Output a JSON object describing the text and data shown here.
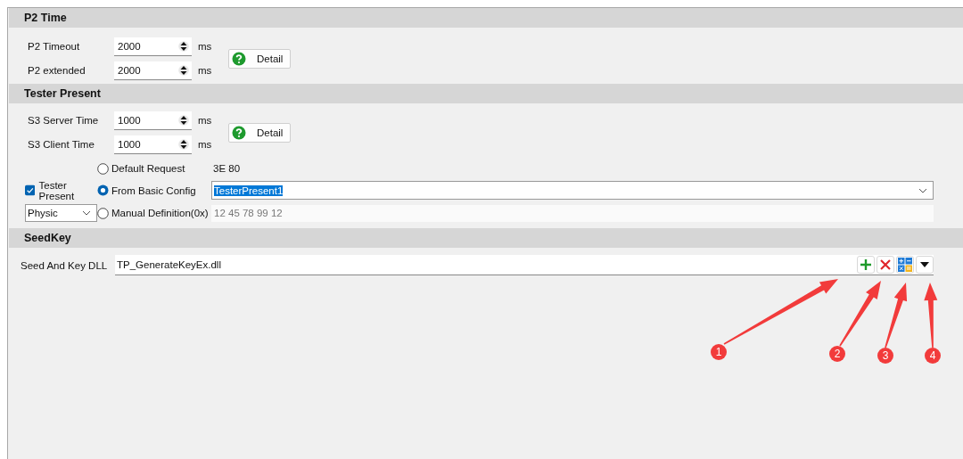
{
  "sections": [
    {
      "kind": "timing",
      "title": "P2 Time",
      "fields": [
        {
          "label": "P2 Timeout",
          "value": "2000",
          "unit": "ms"
        },
        {
          "label": "P2 extended",
          "value": "2000",
          "unit": "ms"
        }
      ],
      "detail_button": "Detail"
    },
    {
      "kind": "tester",
      "title": "Tester Present",
      "fields": [
        {
          "label": "S3 Server Time",
          "value": "1000",
          "unit": "ms"
        },
        {
          "label": "S3 Client Time",
          "value": "1000",
          "unit": "ms"
        }
      ],
      "detail_button": "Detail",
      "tester_present": {
        "label": "Tester Present",
        "checked": true
      },
      "addressing": "Physic",
      "options": [
        {
          "kind": "text",
          "label": "Default Request",
          "selected": false,
          "value": "3E 80"
        },
        {
          "kind": "combo",
          "label": "From Basic Config",
          "selected": true,
          "value": "TesterPresent1"
        },
        {
          "kind": "input",
          "label": "Manual Definition(0x)",
          "selected": false,
          "value": "12 45 78 99 12"
        }
      ]
    },
    {
      "kind": "seedkey",
      "title": "SeedKey",
      "label": "Seed And Key DLL",
      "value": "TP_GenerateKeyEx.dll",
      "tools": [
        {
          "kind": "add"
        },
        {
          "kind": "delete"
        },
        {
          "kind": "grid"
        },
        {
          "kind": "dropdown"
        }
      ]
    }
  ],
  "callouts": [
    {
      "number": "1"
    },
    {
      "number": "2"
    },
    {
      "number": "3"
    },
    {
      "number": "4"
    }
  ]
}
